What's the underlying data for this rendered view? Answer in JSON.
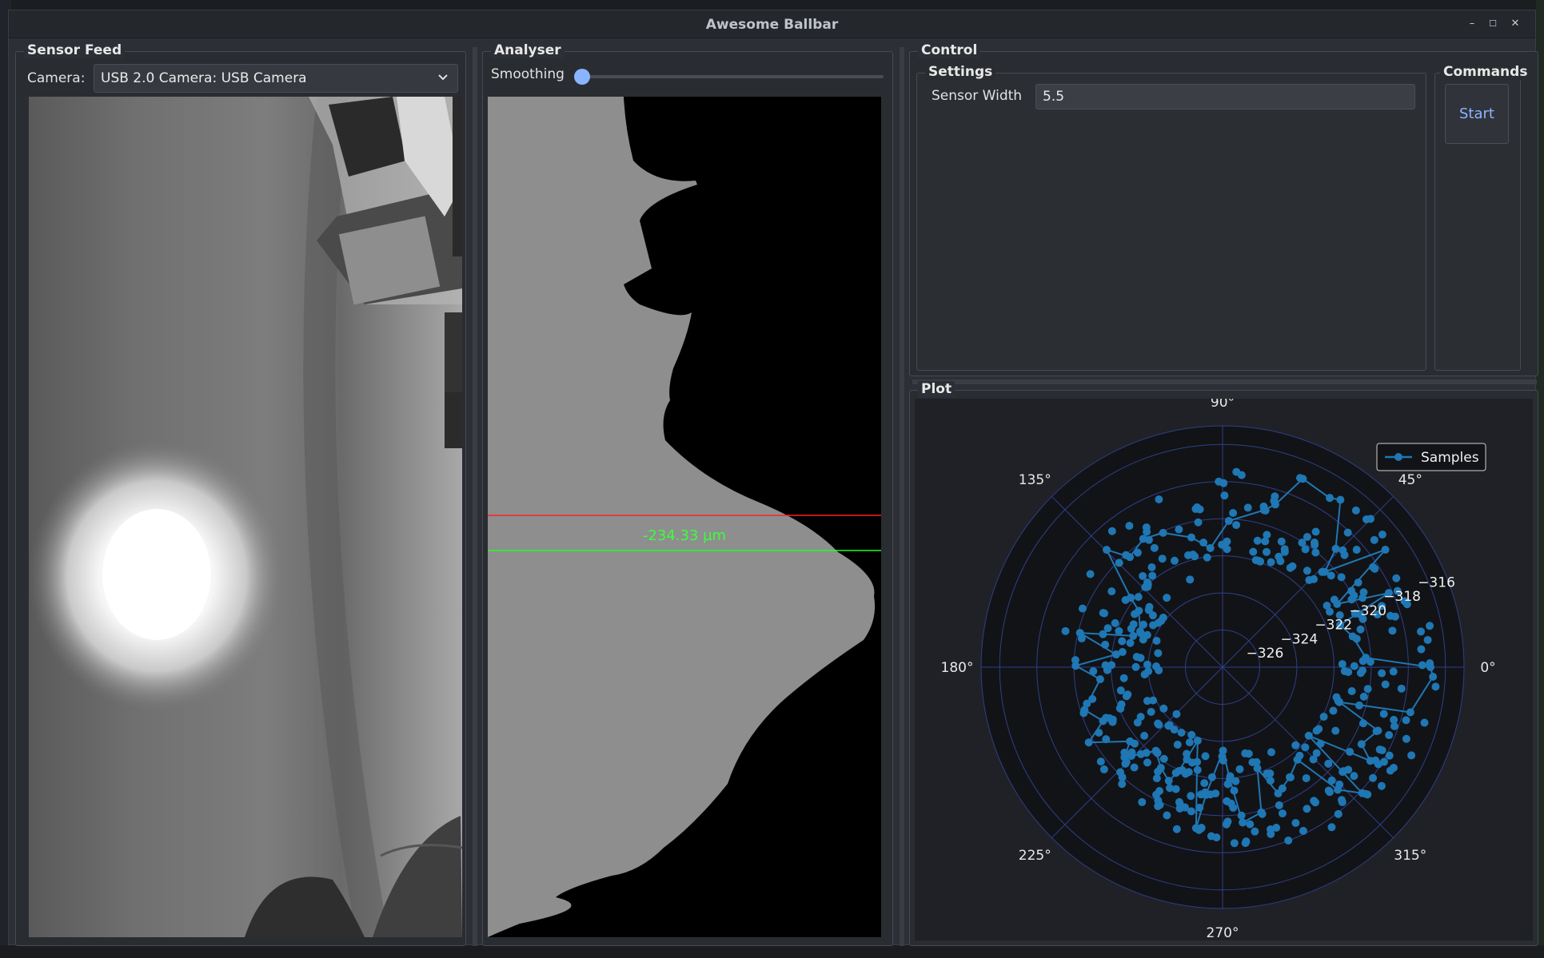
{
  "window": {
    "title": "Awesome Ballbar",
    "minimize": "–",
    "maximize": "☐",
    "close": "✕"
  },
  "sensor_feed": {
    "title": "Sensor Feed",
    "camera_label": "Camera:",
    "camera_value": "USB 2.0 Camera: USB Camera"
  },
  "analyser": {
    "title": "Analyser",
    "smoothing_label": "Smoothing",
    "smoothing_value": 0,
    "measurement": "-234.33 µm"
  },
  "control": {
    "title": "Control",
    "settings": {
      "title": "Settings",
      "sensor_width_label": "Sensor Width",
      "sensor_width_value": "5.5"
    },
    "commands": {
      "title": "Commands",
      "start_label": "Start"
    }
  },
  "plot": {
    "title": "Plot"
  },
  "chart_data": {
    "type": "scatter",
    "projection": "polar",
    "series": [
      {
        "name": "Samples",
        "color": "#1f77b4",
        "marker": "circle",
        "line": true
      }
    ],
    "angle_ticks": [
      "0°",
      "45°",
      "90°",
      "135°",
      "180°",
      "225°",
      "270°",
      "315°"
    ],
    "radial_ticks": [
      "−326",
      "−324",
      "−322",
      "−320",
      "−318",
      "−316"
    ],
    "rlim": [
      -328,
      -315
    ],
    "legend": "top-right",
    "grid": true
  }
}
